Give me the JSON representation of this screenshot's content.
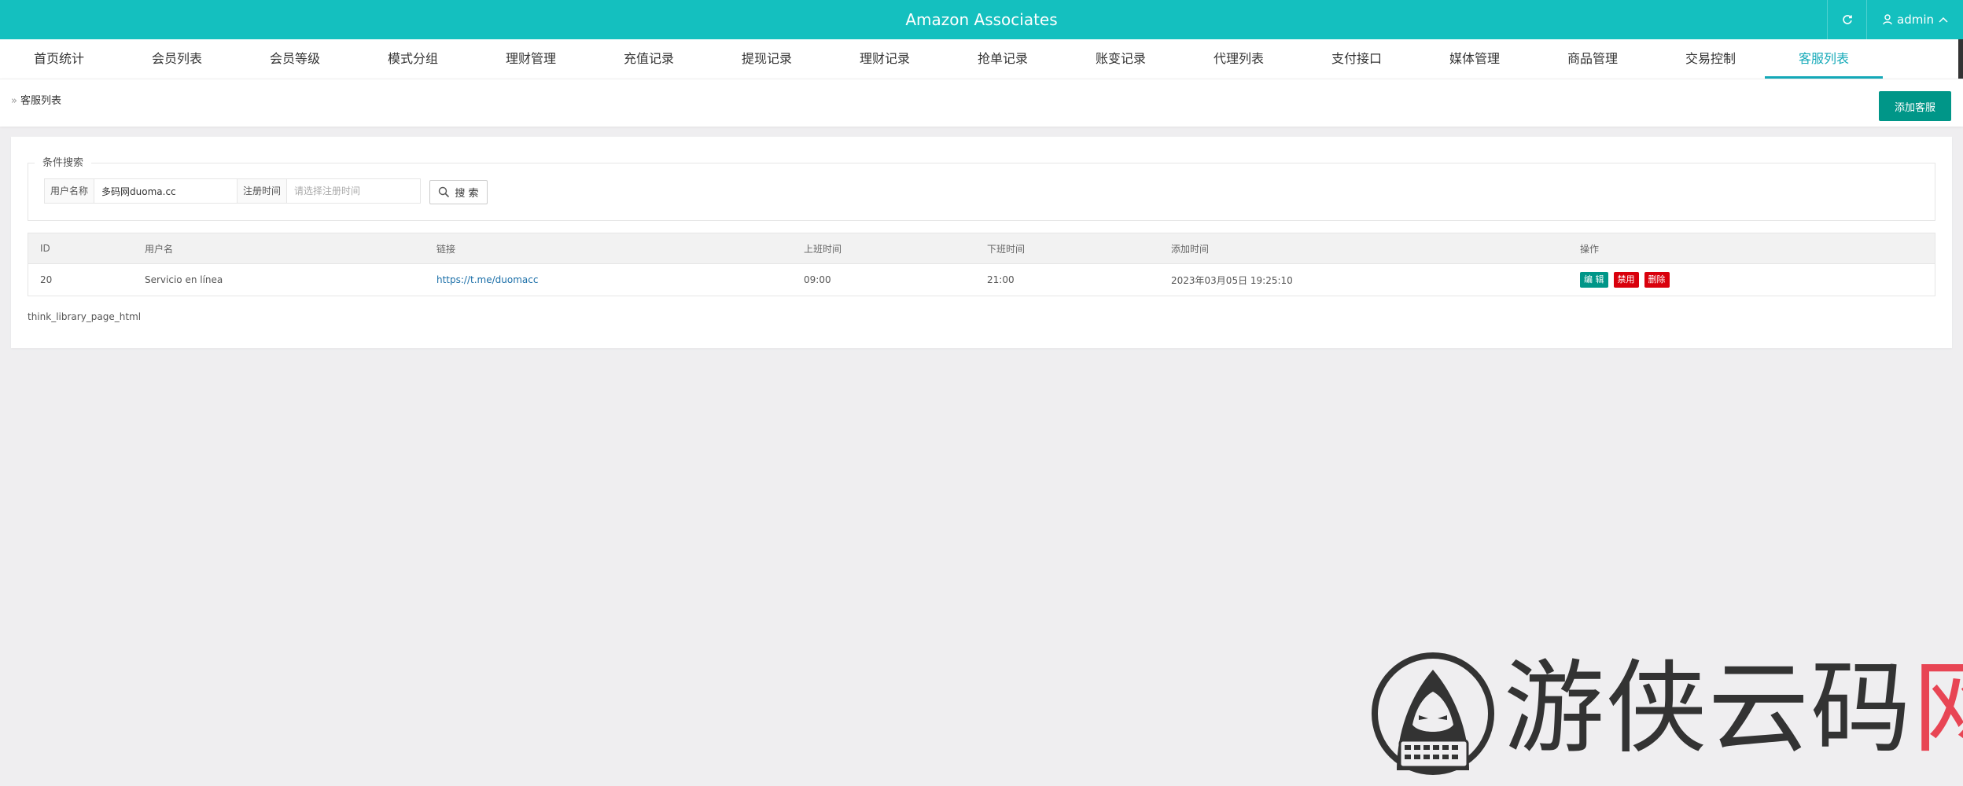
{
  "app": {
    "title": "Amazon Associates",
    "user": "admin"
  },
  "nav": {
    "tabs": [
      {
        "label": "首页统计"
      },
      {
        "label": "会员列表"
      },
      {
        "label": "会员等级"
      },
      {
        "label": "模式分组"
      },
      {
        "label": "理财管理"
      },
      {
        "label": "充值记录"
      },
      {
        "label": "提现记录"
      },
      {
        "label": "理财记录"
      },
      {
        "label": "抢单记录"
      },
      {
        "label": "账变记录"
      },
      {
        "label": "代理列表"
      },
      {
        "label": "支付接口"
      },
      {
        "label": "媒体管理"
      },
      {
        "label": "商品管理"
      },
      {
        "label": "交易控制"
      },
      {
        "label": "客服列表"
      }
    ],
    "active_index": 15
  },
  "breadcrumb": {
    "separator": "»",
    "label": "客服列表"
  },
  "toolbar": {
    "add_label": "添加客服"
  },
  "search": {
    "legend": "条件搜索",
    "username_label": "用户名称",
    "username_value": "多码网duoma.cc",
    "regtime_label": "注册时间",
    "regtime_placeholder": "请选择注册时间",
    "button_label": "搜 索"
  },
  "table": {
    "headers": [
      "ID",
      "用户名",
      "链接",
      "上班时间",
      "下班时间",
      "添加时间",
      "操作"
    ],
    "rows": [
      {
        "id": "20",
        "username": "Servicio en línea",
        "link": "https://t.me/duomacc",
        "start_time": "09:00",
        "end_time": "21:00",
        "added": "2023年03月05日 19:25:10",
        "actions": {
          "edit": "编 辑",
          "disable": "禁用",
          "delete": "删除"
        }
      }
    ]
  },
  "pager_text": "think_library_page_html",
  "watermark": {
    "text": "游侠云码",
    "text_red": "网"
  },
  "colors": {
    "topbar": "#14c0bf",
    "accent": "#009688",
    "danger": "#d9000c",
    "active_tab": "#14a9b8"
  }
}
